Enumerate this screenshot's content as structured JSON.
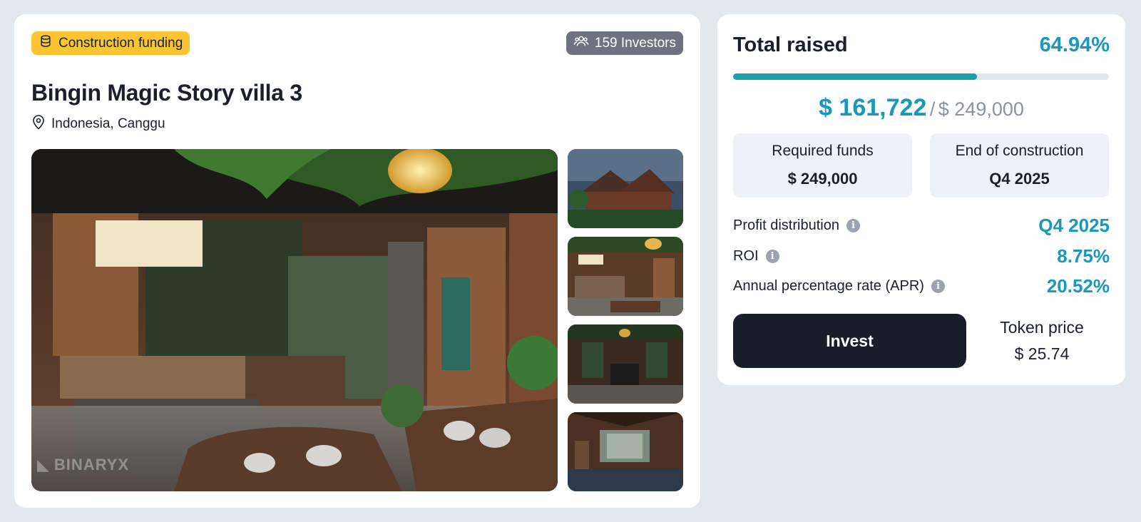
{
  "listing": {
    "badge_label": "Construction funding",
    "badge_icon": "coins-stack-icon",
    "investors_label": "159 Investors",
    "investors_icon": "users-icon",
    "title": "Bingin Magic Story villa 3",
    "location": "Indonesia, Canggu",
    "location_icon": "map-pin-icon",
    "watermark": "BINARYX",
    "thumbnails": [
      {
        "name": "villa-exterior"
      },
      {
        "name": "living-room"
      },
      {
        "name": "lounge-fireplace"
      },
      {
        "name": "bedroom"
      }
    ]
  },
  "funding": {
    "total_label": "Total raised",
    "total_percent": "64.94%",
    "progress_fraction": 0.6494,
    "raised_amount": "$ 161,722",
    "raised_separator": "/",
    "raised_goal": "$ 249,000",
    "required_label": "Required funds",
    "required_value": "$ 249,000",
    "end_label": "End of construction",
    "end_value": "Q4 2025",
    "rows": [
      {
        "label": "Profit distribution",
        "value": "Q4 2025"
      },
      {
        "label": "ROI",
        "value": "8.75%"
      },
      {
        "label": "Annual percentage rate (APR)",
        "value": "20.52%"
      }
    ],
    "invest_label": "Invest",
    "token_label": "Token price",
    "token_value": "$ 25.74"
  },
  "colors": {
    "accent": "#1a98b9",
    "progress": "#1aa0a6",
    "badge": "#fbc531",
    "button": "#181d29"
  }
}
